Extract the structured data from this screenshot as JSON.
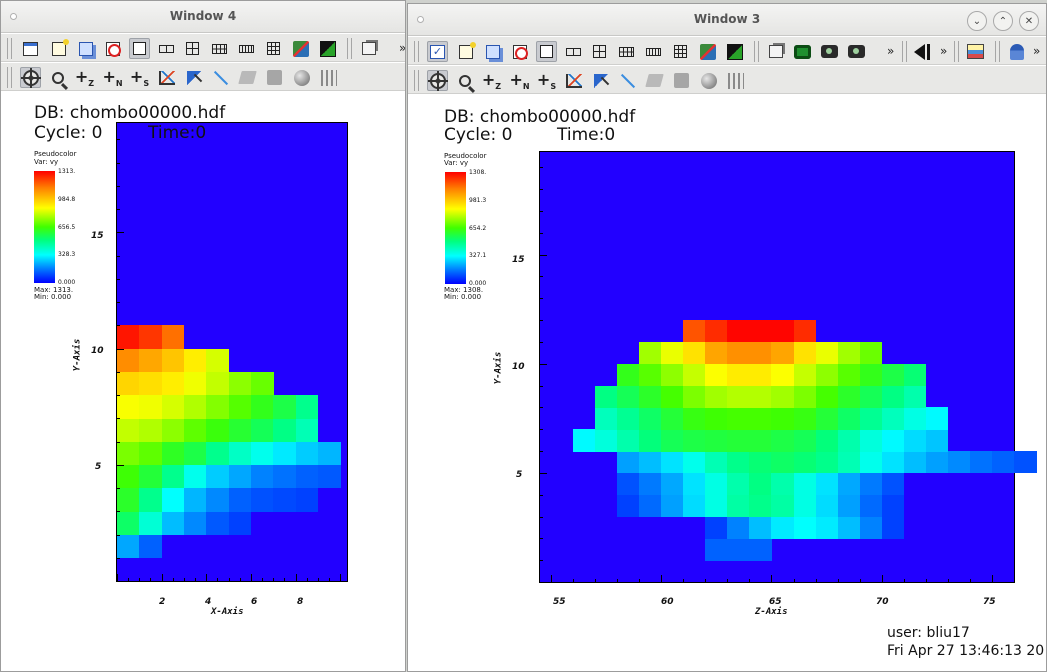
{
  "windows": [
    {
      "id": "win4",
      "title": "Window 4",
      "db_label": "DB: chombo00000.hdf",
      "cycle_label": "Cycle: 0",
      "time_label": "Time:0",
      "legend": {
        "title": "Pseudocolor",
        "var": "Var: vy",
        "ticks": [
          "1313.",
          "984.8",
          "656.5",
          "328.3",
          "0.000"
        ],
        "max": "Max: 1313.",
        "min": "Min: 0.000"
      },
      "x_axis_title": "X-Axis",
      "y_axis_title": "Y-Axis",
      "x_ticks": [
        "2",
        "4",
        "6",
        "8"
      ],
      "y_ticks": [
        "15",
        "10",
        "5"
      ]
    },
    {
      "id": "win3",
      "title": "Window 3",
      "db_label": "DB: chombo00000.hdf",
      "cycle_label": "Cycle: 0",
      "time_label": "Time:0",
      "legend": {
        "title": "Pseudocolor",
        "var": "Var: vy",
        "ticks": [
          "1308.",
          "981.3",
          "654.2",
          "327.1",
          "0.000"
        ],
        "max": "Max: 1308.",
        "min": "Min: 0.000"
      },
      "x_axis_title": "Z-Axis",
      "y_axis_title": "Y-Axis",
      "x_ticks": [
        "55",
        "60",
        "65",
        "70",
        "75"
      ],
      "y_ticks": [
        "15",
        "10",
        "5"
      ],
      "user_label": "user: bliu17",
      "date_label": "Fri Apr 27 13:46:13 20"
    }
  ],
  "window_controls": {
    "minimize": "⌄",
    "maximize": "⌃",
    "close": "✕"
  },
  "toolbar": {
    "more": "»"
  },
  "colors": {
    "plot_background": "#2200ff",
    "colormap": [
      "#0000ff",
      "#0080ff",
      "#00ffff",
      "#00ff80",
      "#40ff00",
      "#ffff00",
      "#ff8000",
      "#ff0000"
    ]
  },
  "chart_data": [
    {
      "type": "heatmap",
      "window": "Window 4",
      "xlabel": "X-Axis",
      "ylabel": "Y-Axis",
      "xlim": [
        0,
        10.3
      ],
      "ylim": [
        0,
        19.7
      ],
      "cell_size": 1,
      "value_range": [
        0,
        1313
      ],
      "rows_from_y0": [
        [
          0,
          0
        ],
        [
          210,
          120
        ],
        [
          520,
          380,
          240,
          170,
          110,
          80
        ],
        [
          600,
          470,
          330,
          230,
          170,
          120,
          100,
          90,
          80
        ],
        [
          650,
          580,
          470,
          350,
          260,
          210,
          160,
          140,
          120,
          110
        ],
        [
          720,
          690,
          610,
          560,
          470,
          400,
          350,
          300,
          260,
          230
        ],
        [
          800,
          780,
          740,
          690,
          640,
          590,
          540,
          480,
          420
        ],
        [
          860,
          850,
          820,
          780,
          730,
          680,
          620,
          560,
          470
        ],
        [
          950,
          930,
          900,
          850,
          800,
          740,
          700
        ],
        [
          1090,
          1040,
          980,
          900,
          820
        ],
        [
          1280,
          1230,
          1140
        ],
        [
          0
        ]
      ]
    },
    {
      "type": "heatmap",
      "window": "Window 3",
      "xlabel": "Z-Axis",
      "ylabel": "Y-Axis",
      "xlim": [
        54.5,
        76.0
      ],
      "ylim": [
        0,
        19.7
      ],
      "cell_size": 1,
      "value_range": [
        0,
        1308
      ],
      "row_x_start": [
        62,
        62,
        58,
        58,
        58,
        56,
        57,
        57,
        58,
        59,
        61
      ],
      "rows_from_y1": [
        [
          120,
          120,
          120
        ],
        [
          80,
          160,
          240,
          300,
          330,
          300,
          240,
          160,
          80
        ],
        [
          80,
          130,
          200,
          280,
          360,
          440,
          470,
          440,
          360,
          280,
          200,
          130,
          80
        ],
        [
          100,
          150,
          210,
          290,
          360,
          430,
          480,
          430,
          360,
          290,
          210,
          150,
          100
        ],
        [
          200,
          240,
          290,
          350,
          420,
          470,
          500,
          520,
          500,
          470,
          420,
          350,
          290,
          240,
          200,
          170,
          140,
          120,
          100
        ],
        [
          320,
          370,
          430,
          490,
          540,
          560,
          570,
          580,
          580,
          560,
          540,
          490,
          430,
          370,
          320,
          280,
          250
        ],
        [
          410,
          460,
          520,
          580,
          630,
          650,
          660,
          660,
          650,
          630,
          580,
          520,
          460,
          410,
          360,
          320
        ],
        [
          480,
          540,
          600,
          660,
          720,
          760,
          780,
          780,
          760,
          720,
          660,
          600,
          540,
          480,
          430
        ],
        [
          620,
          680,
          740,
          800,
          860,
          900,
          900,
          860,
          800,
          740,
          680,
          620,
          560,
          500
        ],
        [
          760,
          840,
          920,
          1040,
          1080,
          1080,
          1040,
          920,
          840,
          760,
          700
        ],
        [
          1180,
          1240,
          1300,
          1300,
          1300,
          1240
        ]
      ]
    }
  ]
}
